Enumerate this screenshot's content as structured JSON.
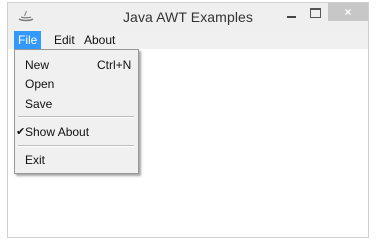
{
  "window": {
    "title": "Java AWT Examples",
    "close_glyph": "×"
  },
  "menubar": {
    "items": [
      {
        "label": "File"
      },
      {
        "label": "Edit"
      },
      {
        "label": "About"
      }
    ]
  },
  "file_menu": {
    "items": [
      {
        "label": "New",
        "shortcut": "Ctrl+N"
      },
      {
        "label": "Open"
      },
      {
        "label": "Save"
      },
      {
        "label": "Show About",
        "checked": true,
        "check_glyph": "✔"
      },
      {
        "label": "Exit"
      }
    ]
  },
  "colors": {
    "accent": "#3399ff",
    "close_button": "#c7c7c7"
  }
}
